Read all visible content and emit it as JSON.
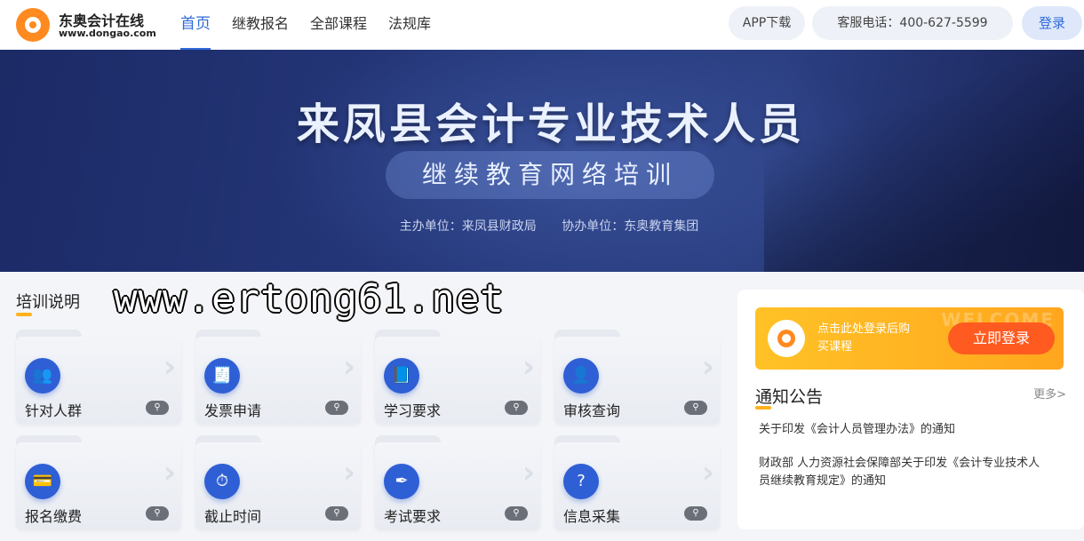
{
  "header": {
    "logo_title": "东奥会计在线",
    "logo_url": "www.dongao.com",
    "nav": [
      "首页",
      "继教报名",
      "全部课程",
      "法规库"
    ],
    "app_download": "APP下载",
    "phone": "客服电话：400-627-5599",
    "login": "登录"
  },
  "banner": {
    "title": "来凤县会计专业技术人员",
    "subtitle": "继续教育网络培训",
    "host": "主办单位：来凤县财政局",
    "cohost": "协办单位：东奥教育集团"
  },
  "training": {
    "title": "培训说明",
    "watermark": "www.ertong61.net",
    "cards": [
      {
        "label": "针对人群",
        "icon": "people-icon",
        "glyph": "👥"
      },
      {
        "label": "发票申请",
        "icon": "invoice-icon",
        "glyph": "🧾"
      },
      {
        "label": "学习要求",
        "icon": "book-icon",
        "glyph": "📘"
      },
      {
        "label": "审核查询",
        "icon": "person-icon",
        "glyph": "👤"
      },
      {
        "label": "报名缴费",
        "icon": "wallet-icon",
        "glyph": "💳"
      },
      {
        "label": "截止时间",
        "icon": "stopwatch-icon",
        "glyph": "⏱"
      },
      {
        "label": "考试要求",
        "icon": "pen-icon",
        "glyph": "✒"
      },
      {
        "label": "信息采集",
        "icon": "clipboard-icon",
        "glyph": "?"
      }
    ]
  },
  "sidebar": {
    "login_banner_bg": "WELCOME",
    "login_text": "点击此处登录后购买课程",
    "login_button": "立即登录",
    "notice_title": "通知公告",
    "notice_more": "更多>",
    "notices": [
      "关于印发《会计人员管理办法》的通知",
      "财政部 人力资源社会保障部关于印发《会计专业技术人员继续教育规定》的通知"
    ]
  },
  "colors": {
    "accent": "#2f6ad8",
    "orange": "#ffa61e",
    "login_button": "#ff5a1f"
  }
}
